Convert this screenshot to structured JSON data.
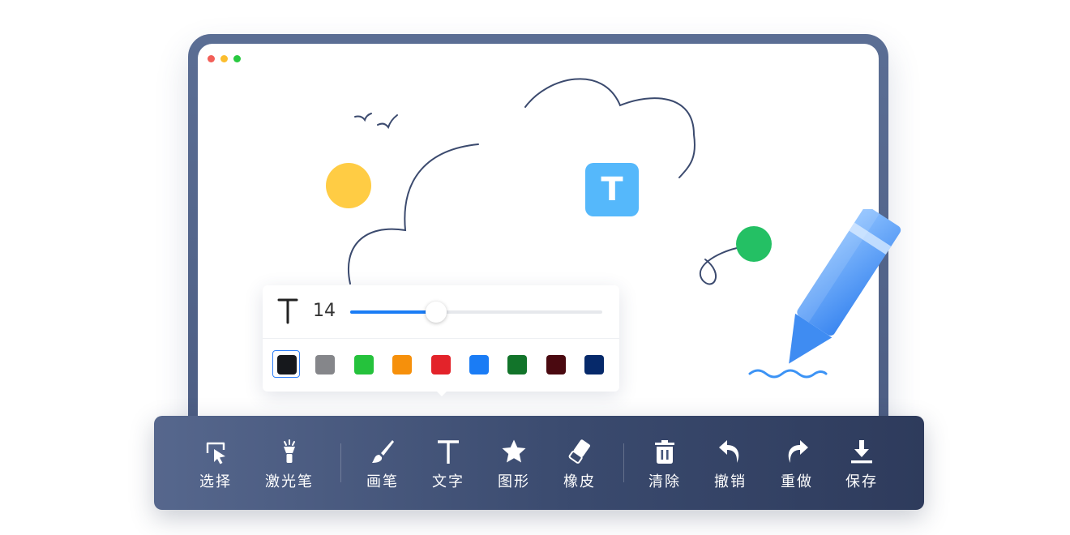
{
  "window": {
    "dot_colors": [
      "#f25f58",
      "#fbbd2e",
      "#29c940"
    ]
  },
  "canvas": {
    "text_badge": "T",
    "colors": {
      "sun": "#ffcc44",
      "ball": "#24c064",
      "badge": "#55b8fb",
      "line": "#3b4a6e"
    }
  },
  "text_panel": {
    "font_icon": "text-t-icon",
    "font_size": "14",
    "slider_fraction": 0.34,
    "slider_accent": "#1a7cf5",
    "selected_color_index": 0,
    "colors": [
      "#16181c",
      "#85868a",
      "#25c23c",
      "#f6900b",
      "#e3232a",
      "#1a7cf5",
      "#12742a",
      "#4a0910",
      "#06296a"
    ]
  },
  "toolbar": {
    "items": [
      {
        "label": "选择",
        "icon": "select-pointer-icon"
      },
      {
        "label": "激光笔",
        "icon": "laser-pointer-icon"
      },
      {
        "label": "画笔",
        "icon": "brush-icon"
      },
      {
        "label": "文字",
        "icon": "text-icon"
      },
      {
        "label": "图形",
        "icon": "star-shape-icon"
      },
      {
        "label": "橡皮",
        "icon": "eraser-icon"
      },
      {
        "label": "清除",
        "icon": "trash-icon"
      },
      {
        "label": "撤销",
        "icon": "undo-icon"
      },
      {
        "label": "重做",
        "icon": "redo-icon"
      },
      {
        "label": "保存",
        "icon": "download-save-icon"
      }
    ]
  },
  "decor": {
    "pen_icon": "pencil-illustration-icon"
  }
}
